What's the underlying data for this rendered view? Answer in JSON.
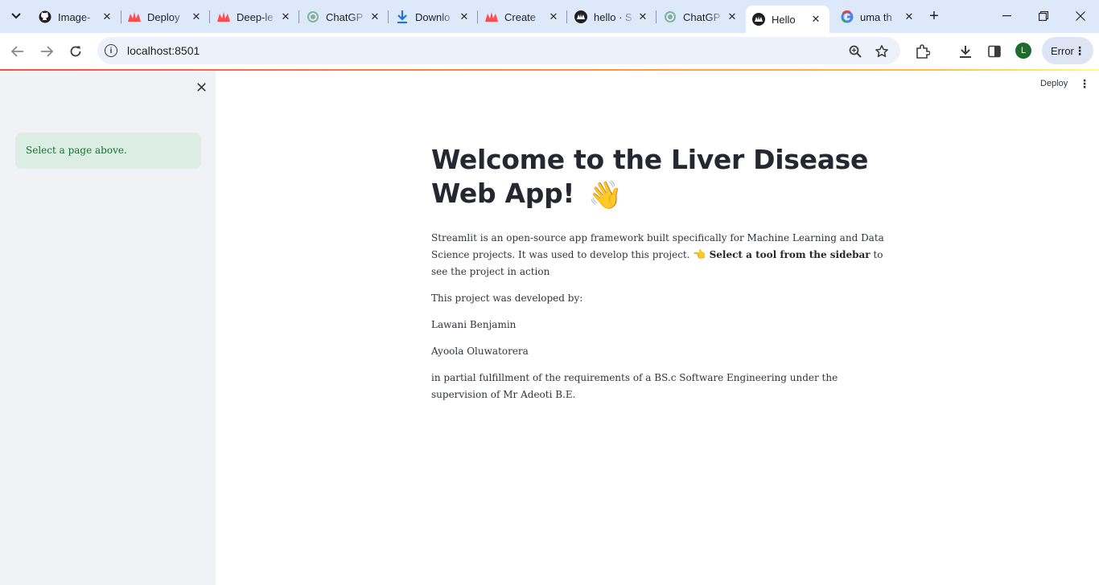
{
  "browser": {
    "tabs": [
      {
        "title": "Image-",
        "icon": "github-icon"
      },
      {
        "title": "Deploy",
        "icon": "streamlit-icon"
      },
      {
        "title": "Deep-le",
        "icon": "streamlit-icon"
      },
      {
        "title": "ChatGP",
        "icon": "chatgpt-icon"
      },
      {
        "title": "Downlo",
        "icon": "download-icon"
      },
      {
        "title": "Create",
        "icon": "streamlit-icon"
      },
      {
        "title": "hello · S",
        "icon": "streamlit-icon"
      },
      {
        "title": "ChatGP",
        "icon": "chatgpt-icon"
      },
      {
        "title": "Hello",
        "icon": "streamlit-icon",
        "active": true
      },
      {
        "title": "uma th",
        "icon": "google-icon"
      }
    ],
    "url": "localhost:8501",
    "profile_initial": "L",
    "error_button_label": "Error",
    "accent_color": "#1e6b2c"
  },
  "app": {
    "deploy_label": "Deploy",
    "sidebar": {
      "alert_text": "Select a page above.",
      "alert_bg": "#dcede4",
      "alert_color": "#177233"
    },
    "main": {
      "title": "Welcome to the Liver Disease Web App!",
      "title_emoji": "👋",
      "intro_text": "Streamlit is an open-source app framework built specifically for Machine Learning and Data Science projects. It was used to develop this project.",
      "pointer_emoji": "👈",
      "intro_bold": "Select a tool from the sidebar",
      "intro_tail": "to see the project in action",
      "developed_by": "This project was developed by:",
      "developers": [
        "Lawani Benjamin",
        "Ayoola Oluwatorera"
      ],
      "fulfillment": "in partial fulfillment of the requirements of a BS.c Software Engineering under the supervision of Mr Adeoti B.E."
    }
  }
}
